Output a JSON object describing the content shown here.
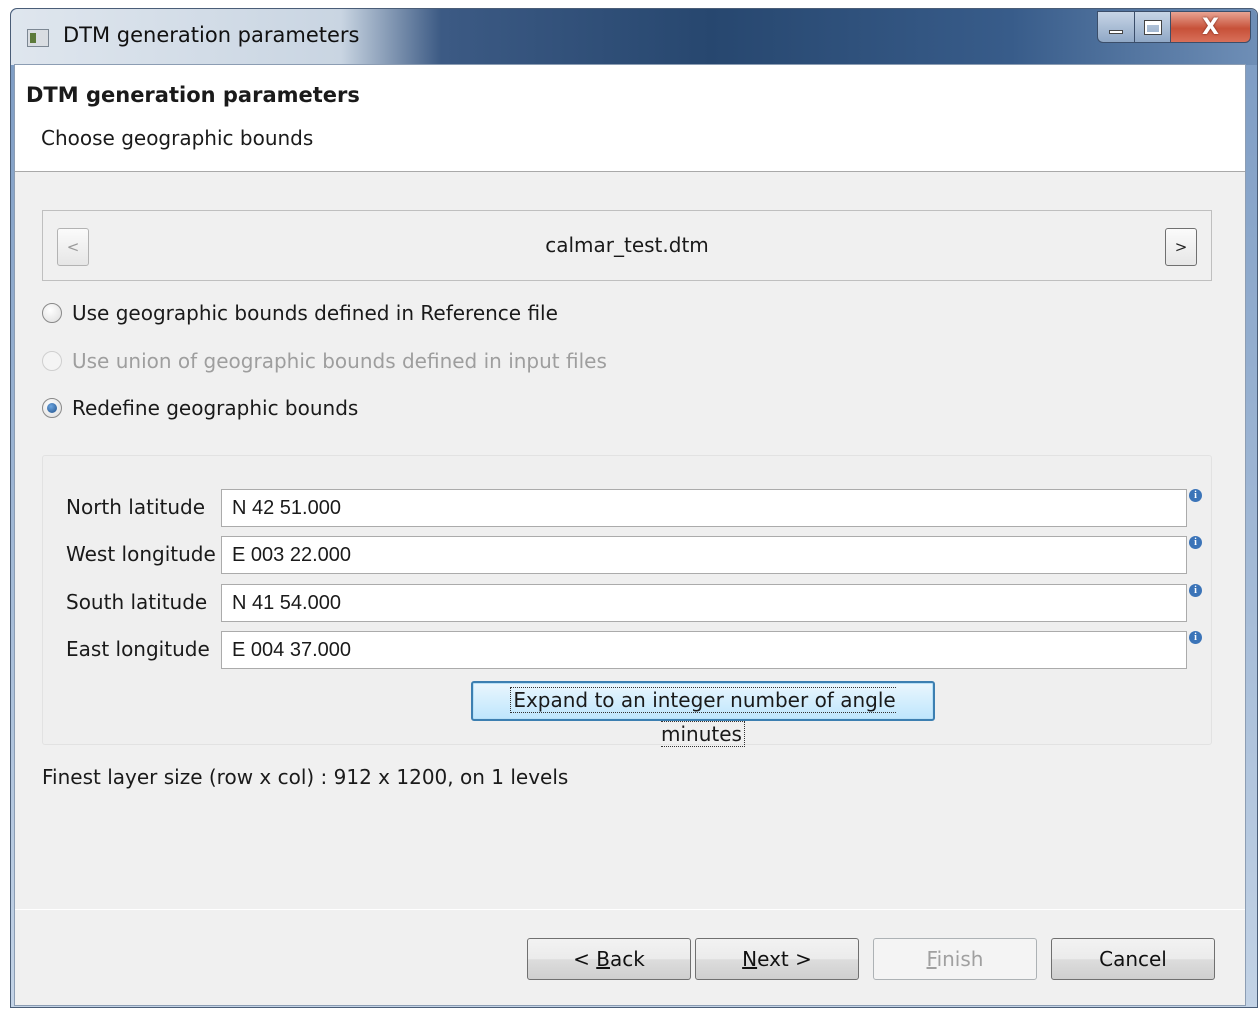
{
  "window": {
    "title": "DTM generation parameters",
    "close_glyph": "X"
  },
  "header": {
    "title": "DTM generation parameters",
    "description": "Choose geographic bounds"
  },
  "file_nav": {
    "prev_label": "<",
    "next_label": ">",
    "file_name": "calmar_test.dtm"
  },
  "bounds_options": [
    {
      "label": "Use geographic bounds defined in Reference file",
      "checked": false,
      "enabled": true
    },
    {
      "label": "Use union of geographic bounds defined in input files",
      "checked": false,
      "enabled": false
    },
    {
      "label": "Redefine geographic bounds",
      "checked": true,
      "enabled": true
    }
  ],
  "fields": [
    {
      "label": "North latitude",
      "value": "N 42 51.000"
    },
    {
      "label": "West longitude",
      "value": "E 003 22.000"
    },
    {
      "label": "South latitude",
      "value": "N 41 54.000"
    },
    {
      "label": "East longitude",
      "value": "E 004 37.000"
    }
  ],
  "expand_button_label": "Expand to an integer number of angle minutes",
  "layer_info": "Finest layer size (row x col) : 912 x 1200, on 1 levels",
  "buttons": {
    "back": {
      "prefix": "< ",
      "mnemonic": "B",
      "rest": "ack"
    },
    "next": {
      "mnemonic": "N",
      "rest": "ext >"
    },
    "finish": {
      "mnemonic": "F",
      "rest": "inish"
    },
    "cancel": "Cancel"
  },
  "icons": {
    "info": "info-icon",
    "app": "app-icon"
  }
}
